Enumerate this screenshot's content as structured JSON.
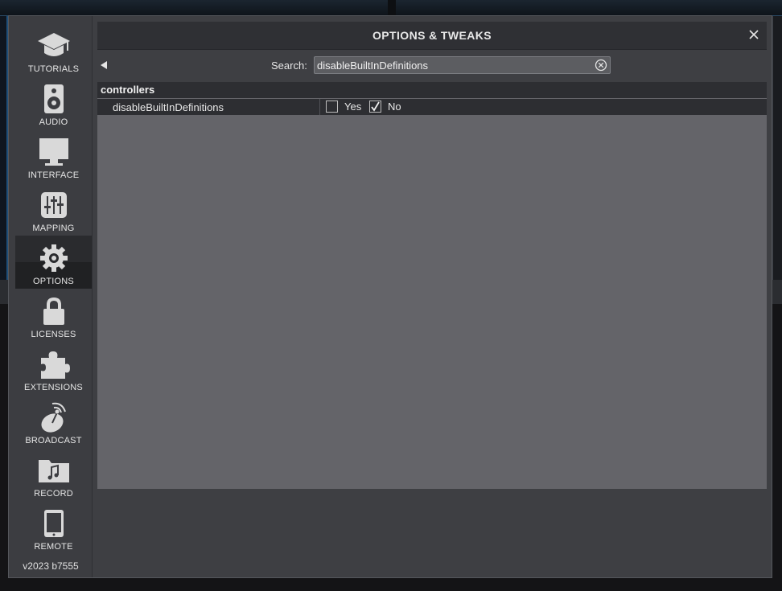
{
  "dialog": {
    "title": "OPTIONS & TWEAKS",
    "close_icon": "close-icon",
    "back_icon": "back-arrow-icon"
  },
  "sidebar": {
    "items": [
      {
        "id": "tutorials",
        "label": "TUTORIALS",
        "icon": "graduation-cap-icon",
        "active": false
      },
      {
        "id": "audio",
        "label": "AUDIO",
        "icon": "speaker-icon",
        "active": false
      },
      {
        "id": "interface",
        "label": "INTERFACE",
        "icon": "monitor-icon",
        "active": false
      },
      {
        "id": "mapping",
        "label": "MAPPING",
        "icon": "sliders-icon",
        "active": false
      },
      {
        "id": "options",
        "label": "OPTIONS",
        "icon": "gear-icon",
        "active": true
      },
      {
        "id": "licenses",
        "label": "LICENSES",
        "icon": "lock-icon",
        "active": false
      },
      {
        "id": "extensions",
        "label": "EXTENSIONS",
        "icon": "puzzle-icon",
        "active": false
      },
      {
        "id": "broadcast",
        "label": "BROADCAST",
        "icon": "satellite-dish-icon",
        "active": false
      },
      {
        "id": "record",
        "label": "RECORD",
        "icon": "music-folder-icon",
        "active": false
      },
      {
        "id": "remote",
        "label": "REMOTE",
        "icon": "tablet-icon",
        "active": false
      }
    ],
    "version": "v2023 b7555"
  },
  "search": {
    "label": "Search:",
    "value": "disableBuiltInDefinitions",
    "clear_icon": "clear-circle-icon"
  },
  "options": {
    "group": "controllers",
    "rows": [
      {
        "name": "disableBuiltInDefinitions",
        "choices": [
          {
            "label": "Yes",
            "checked": false
          },
          {
            "label": "No",
            "checked": true
          }
        ]
      }
    ]
  },
  "colors": {
    "panel_bg": "#646469",
    "header_bg": "#2d2e32",
    "sidebar_bg": "#3c3d41",
    "accent_blue": "#1f4f7a"
  }
}
